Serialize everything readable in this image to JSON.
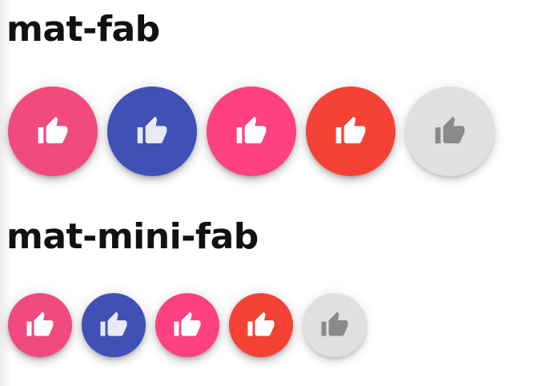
{
  "sections": {
    "fab_title": "mat-fab",
    "mini_title": "mat-mini-fab"
  },
  "fab_buttons": [
    {
      "variant": "basic",
      "bg": "#f14a7f",
      "icon_color": "#ffffff",
      "icon": "thumb-up-icon"
    },
    {
      "variant": "primary",
      "bg": "#3f51b5",
      "icon_color": "#e8eaf6",
      "icon": "thumb-up-icon"
    },
    {
      "variant": "accent",
      "bg": "#ff4081",
      "icon_color": "#ffffff",
      "icon": "thumb-up-icon"
    },
    {
      "variant": "warn",
      "bg": "#f44336",
      "icon_color": "#ffffff",
      "icon": "thumb-up-icon"
    },
    {
      "variant": "disabled",
      "bg": "#e0e0e0",
      "icon_color": "#8a8a8a",
      "icon": "thumb-up-icon"
    }
  ],
  "mini_fab_buttons": [
    {
      "variant": "basic",
      "bg": "#f14a7f",
      "icon_color": "#ffffff",
      "icon": "thumb-up-icon"
    },
    {
      "variant": "primary",
      "bg": "#3f51b5",
      "icon_color": "#e8eaf6",
      "icon": "thumb-up-icon"
    },
    {
      "variant": "accent",
      "bg": "#ff4081",
      "icon_color": "#ffffff",
      "icon": "thumb-up-icon"
    },
    {
      "variant": "warn",
      "bg": "#f44336",
      "icon_color": "#ffffff",
      "icon": "thumb-up-icon"
    },
    {
      "variant": "disabled",
      "bg": "#e0e0e0",
      "icon_color": "#8a8a8a",
      "icon": "thumb-up-icon"
    }
  ]
}
